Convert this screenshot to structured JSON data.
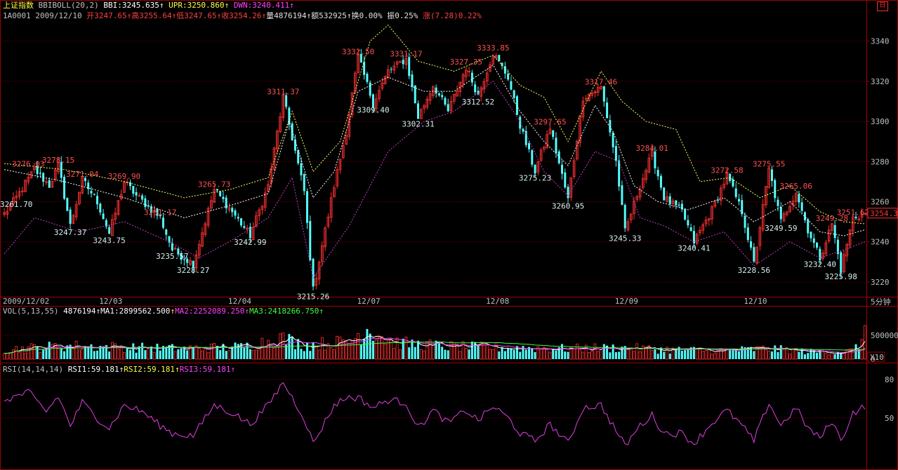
{
  "title": "上证指数",
  "corner_button": "日",
  "indicator_header": {
    "name": "BBIBOLL(20,2)",
    "bbi": "BBI:3245.635",
    "upr": "UPR:3250.860",
    "dwn": "DWN:3240.411"
  },
  "quote_line": {
    "code": "1A0001",
    "date": "2009/12/10",
    "open": "开3247.65",
    "high": "高3255.64",
    "low": "低3247.65",
    "close": "收3254.26",
    "volume": "量4876194",
    "amount": "额532925",
    "turnover": "换0.00%",
    "amplitude": "振0.25%",
    "change": "涨(7.28)0.22%"
  },
  "vol_header": {
    "name": "VOL(5,13,55)",
    "vol": "4876194",
    "ma1": "MA1:2899562.500",
    "ma2": "MA2:2252089.250",
    "ma3": "MA3:2418266.750"
  },
  "rsi_header": {
    "name": "RSI(14,14,14)",
    "rsi1": "RSI1:59.181",
    "rsi2": "RSI2:59.181",
    "rsi3": "RSI3:59.181"
  },
  "chart_data": {
    "type": "candlestick",
    "period": "5分钟",
    "current_price_label": "3254.3",
    "price_axis": {
      "ticks": [
        3220,
        3240,
        3260,
        3280,
        3300,
        3320,
        3340
      ],
      "range": [
        3213,
        3350
      ]
    },
    "time_axis": [
      {
        "label": "2009/12/02",
        "bar": 0
      },
      {
        "label": "12/03",
        "bar": 36
      },
      {
        "label": "12/04",
        "bar": 79
      },
      {
        "label": "12/07",
        "bar": 122
      },
      {
        "label": "12/08",
        "bar": 165
      },
      {
        "label": "12/09",
        "bar": 208
      },
      {
        "label": "12/10",
        "bar": 251
      }
    ],
    "bar_count": 288,
    "price_anchors": [
      [
        0,
        3254
      ],
      [
        4,
        3262
      ],
      [
        10,
        3276
      ],
      [
        15,
        3268
      ],
      [
        18,
        3278
      ],
      [
        22,
        3248
      ],
      [
        26,
        3271
      ],
      [
        31,
        3260
      ],
      [
        35,
        3244
      ],
      [
        40,
        3270
      ],
      [
        44,
        3263
      ],
      [
        52,
        3252
      ],
      [
        56,
        3236
      ],
      [
        63,
        3229
      ],
      [
        70,
        3266
      ],
      [
        76,
        3255
      ],
      [
        82,
        3243
      ],
      [
        88,
        3268
      ],
      [
        93,
        3312
      ],
      [
        100,
        3265
      ],
      [
        103,
        3216
      ],
      [
        110,
        3268
      ],
      [
        114,
        3295
      ],
      [
        118,
        3332
      ],
      [
        123,
        3309
      ],
      [
        128,
        3325
      ],
      [
        134,
        3331
      ],
      [
        138,
        3302
      ],
      [
        143,
        3318
      ],
      [
        148,
        3305
      ],
      [
        154,
        3327
      ],
      [
        158,
        3313
      ],
      [
        163,
        3334
      ],
      [
        168,
        3322
      ],
      [
        172,
        3298
      ],
      [
        177,
        3275
      ],
      [
        182,
        3297
      ],
      [
        188,
        3261
      ],
      [
        193,
        3312
      ],
      [
        199,
        3317
      ],
      [
        204,
        3280
      ],
      [
        207,
        3245
      ],
      [
        212,
        3268
      ],
      [
        216,
        3284
      ],
      [
        220,
        3262
      ],
      [
        226,
        3255
      ],
      [
        230,
        3240
      ],
      [
        236,
        3256
      ],
      [
        241,
        3273
      ],
      [
        246,
        3255
      ],
      [
        250,
        3229
      ],
      [
        255,
        3276
      ],
      [
        259,
        3250
      ],
      [
        264,
        3265
      ],
      [
        268,
        3246
      ],
      [
        272,
        3232
      ],
      [
        276,
        3249
      ],
      [
        279,
        3226
      ],
      [
        283,
        3252
      ],
      [
        287,
        3254
      ]
    ],
    "bbi_anchors": [
      [
        0,
        3276
      ],
      [
        20,
        3270
      ],
      [
        40,
        3262
      ],
      [
        60,
        3252
      ],
      [
        75,
        3258
      ],
      [
        88,
        3264
      ],
      [
        95,
        3300
      ],
      [
        103,
        3262
      ],
      [
        110,
        3275
      ],
      [
        118,
        3315
      ],
      [
        128,
        3322
      ],
      [
        140,
        3315
      ],
      [
        150,
        3315
      ],
      [
        163,
        3328
      ],
      [
        172,
        3305
      ],
      [
        180,
        3290
      ],
      [
        188,
        3278
      ],
      [
        197,
        3308
      ],
      [
        203,
        3295
      ],
      [
        210,
        3268
      ],
      [
        218,
        3260
      ],
      [
        228,
        3256
      ],
      [
        240,
        3262
      ],
      [
        250,
        3250
      ],
      [
        262,
        3260
      ],
      [
        272,
        3245
      ],
      [
        280,
        3243
      ],
      [
        287,
        3246
      ]
    ],
    "upr_anchors": [
      [
        0,
        3279
      ],
      [
        20,
        3276
      ],
      [
        40,
        3270
      ],
      [
        60,
        3262
      ],
      [
        75,
        3266
      ],
      [
        88,
        3272
      ],
      [
        96,
        3305
      ],
      [
        103,
        3275
      ],
      [
        112,
        3290
      ],
      [
        122,
        3340
      ],
      [
        128,
        3348
      ],
      [
        138,
        3330
      ],
      [
        150,
        3325
      ],
      [
        163,
        3333
      ],
      [
        172,
        3318
      ],
      [
        180,
        3312
      ],
      [
        188,
        3290
      ],
      [
        199,
        3325
      ],
      [
        206,
        3310
      ],
      [
        214,
        3300
      ],
      [
        224,
        3296
      ],
      [
        232,
        3270
      ],
      [
        242,
        3272
      ],
      [
        252,
        3262
      ],
      [
        262,
        3268
      ],
      [
        272,
        3255
      ],
      [
        280,
        3250
      ],
      [
        287,
        3249
      ]
    ],
    "dwn_anchors": [
      [
        0,
        3234
      ],
      [
        10,
        3252
      ],
      [
        25,
        3245
      ],
      [
        40,
        3250
      ],
      [
        55,
        3240
      ],
      [
        65,
        3232
      ],
      [
        75,
        3240
      ],
      [
        88,
        3252
      ],
      [
        96,
        3272
      ],
      [
        103,
        3222
      ],
      [
        115,
        3248
      ],
      [
        128,
        3285
      ],
      [
        140,
        3300
      ],
      [
        150,
        3305
      ],
      [
        163,
        3320
      ],
      [
        172,
        3300
      ],
      [
        180,
        3275
      ],
      [
        188,
        3263
      ],
      [
        197,
        3285
      ],
      [
        205,
        3280
      ],
      [
        212,
        3252
      ],
      [
        220,
        3248
      ],
      [
        230,
        3240
      ],
      [
        240,
        3245
      ],
      [
        250,
        3228
      ],
      [
        262,
        3240
      ],
      [
        272,
        3232
      ],
      [
        280,
        3236
      ],
      [
        287,
        3240
      ]
    ],
    "high_labels": [
      {
        "text": "3276.03",
        "bar": 8,
        "price": 3276
      },
      {
        "text": "3278.15",
        "bar": 18,
        "price": 3278
      },
      {
        "text": "3271.04",
        "bar": 26,
        "price": 3271
      },
      {
        "text": "3269.90",
        "bar": 40,
        "price": 3270
      },
      {
        "text": "3251.17",
        "bar": 52,
        "price": 3252
      },
      {
        "text": "3265.73",
        "bar": 70,
        "price": 3266
      },
      {
        "text": "3311.37",
        "bar": 93,
        "price": 3312
      },
      {
        "text": "3332.50",
        "bar": 118,
        "price": 3332
      },
      {
        "text": "3331.17",
        "bar": 134,
        "price": 3331
      },
      {
        "text": "3327.35",
        "bar": 154,
        "price": 3327
      },
      {
        "text": "3333.85",
        "bar": 163,
        "price": 3334
      },
      {
        "text": "3297.65",
        "bar": 182,
        "price": 3297
      },
      {
        "text": "3317.46",
        "bar": 199,
        "price": 3317
      },
      {
        "text": "3284.01",
        "bar": 216,
        "price": 3284
      },
      {
        "text": "3272.58",
        "bar": 241,
        "price": 3273
      },
      {
        "text": "3275.55",
        "bar": 255,
        "price": 3276
      },
      {
        "text": "3265.06",
        "bar": 264,
        "price": 3265
      },
      {
        "text": "3249.28",
        "bar": 276,
        "price": 3249
      },
      {
        "text": "3251.62",
        "bar": 283,
        "price": 3252
      }
    ],
    "low_labels": [
      {
        "text": "3261.70",
        "bar": 4,
        "price": 3262
      },
      {
        "text": "3247.37",
        "bar": 22,
        "price": 3248
      },
      {
        "text": "3243.75",
        "bar": 35,
        "price": 3244
      },
      {
        "text": "3235.57",
        "bar": 56,
        "price": 3236
      },
      {
        "text": "3228.27",
        "bar": 63,
        "price": 3229
      },
      {
        "text": "3242.99",
        "bar": 82,
        "price": 3243
      },
      {
        "text": "3215.26",
        "bar": 103,
        "price": 3216
      },
      {
        "text": "3309.40",
        "bar": 123,
        "price": 3309
      },
      {
        "text": "3302.31",
        "bar": 138,
        "price": 3302
      },
      {
        "text": "3312.52",
        "bar": 158,
        "price": 3313
      },
      {
        "text": "3275.23",
        "bar": 177,
        "price": 3275
      },
      {
        "text": "3260.95",
        "bar": 188,
        "price": 3261
      },
      {
        "text": "3245.33",
        "bar": 207,
        "price": 3245
      },
      {
        "text": "3240.41",
        "bar": 230,
        "price": 3240
      },
      {
        "text": "3228.56",
        "bar": 250,
        "price": 3229
      },
      {
        "text": "3249.59",
        "bar": 259,
        "price": 3250
      },
      {
        "text": "3232.40",
        "bar": 272,
        "price": 3232
      },
      {
        "text": "3225.98",
        "bar": 279,
        "price": 3226
      }
    ],
    "volume_axis": {
      "ticks": [
        {
          "label": "500000",
          "value": 5000000
        },
        {
          "label": "0",
          "value": 0
        }
      ],
      "range": [
        0,
        8800000
      ],
      "unit_label": "X10"
    },
    "volume_anchors": [
      [
        0,
        2000000
      ],
      [
        20,
        2800000
      ],
      [
        40,
        2500000
      ],
      [
        60,
        2200000
      ],
      [
        80,
        2600000
      ],
      [
        92,
        4400000
      ],
      [
        100,
        3000000
      ],
      [
        115,
        3600000
      ],
      [
        121,
        6500000
      ],
      [
        130,
        3400000
      ],
      [
        150,
        2600000
      ],
      [
        170,
        2400000
      ],
      [
        190,
        2200000
      ],
      [
        205,
        2400000
      ],
      [
        220,
        2000000
      ],
      [
        240,
        1800000
      ],
      [
        255,
        2200000
      ],
      [
        270,
        1500000
      ],
      [
        283,
        1700000
      ],
      [
        287,
        4900000
      ]
    ],
    "rsi_axis": {
      "ticks": [
        80,
        50
      ],
      "range": [
        12,
        85
      ]
    },
    "rsi_anchors": [
      [
        0,
        64
      ],
      [
        8,
        70
      ],
      [
        14,
        55
      ],
      [
        18,
        67
      ],
      [
        22,
        44
      ],
      [
        26,
        62
      ],
      [
        31,
        50
      ],
      [
        35,
        42
      ],
      [
        40,
        60
      ],
      [
        46,
        55
      ],
      [
        52,
        44
      ],
      [
        56,
        38
      ],
      [
        63,
        36
      ],
      [
        70,
        60
      ],
      [
        76,
        54
      ],
      [
        82,
        45
      ],
      [
        88,
        60
      ],
      [
        93,
        78
      ],
      [
        100,
        50
      ],
      [
        103,
        30
      ],
      [
        110,
        60
      ],
      [
        114,
        66
      ],
      [
        118,
        66
      ],
      [
        123,
        58
      ],
      [
        128,
        64
      ],
      [
        134,
        62
      ],
      [
        138,
        42
      ],
      [
        143,
        56
      ],
      [
        148,
        46
      ],
      [
        154,
        56
      ],
      [
        158,
        48
      ],
      [
        163,
        59
      ],
      [
        168,
        50
      ],
      [
        172,
        38
      ],
      [
        177,
        32
      ],
      [
        182,
        45
      ],
      [
        188,
        30
      ],
      [
        193,
        58
      ],
      [
        199,
        60
      ],
      [
        204,
        40
      ],
      [
        207,
        28
      ],
      [
        212,
        44
      ],
      [
        216,
        52
      ],
      [
        220,
        38
      ],
      [
        226,
        38
      ],
      [
        230,
        30
      ],
      [
        236,
        46
      ],
      [
        241,
        56
      ],
      [
        246,
        44
      ],
      [
        250,
        32
      ],
      [
        255,
        62
      ],
      [
        259,
        44
      ],
      [
        264,
        58
      ],
      [
        268,
        42
      ],
      [
        272,
        34
      ],
      [
        276,
        48
      ],
      [
        279,
        32
      ],
      [
        283,
        54
      ],
      [
        287,
        59
      ]
    ]
  }
}
